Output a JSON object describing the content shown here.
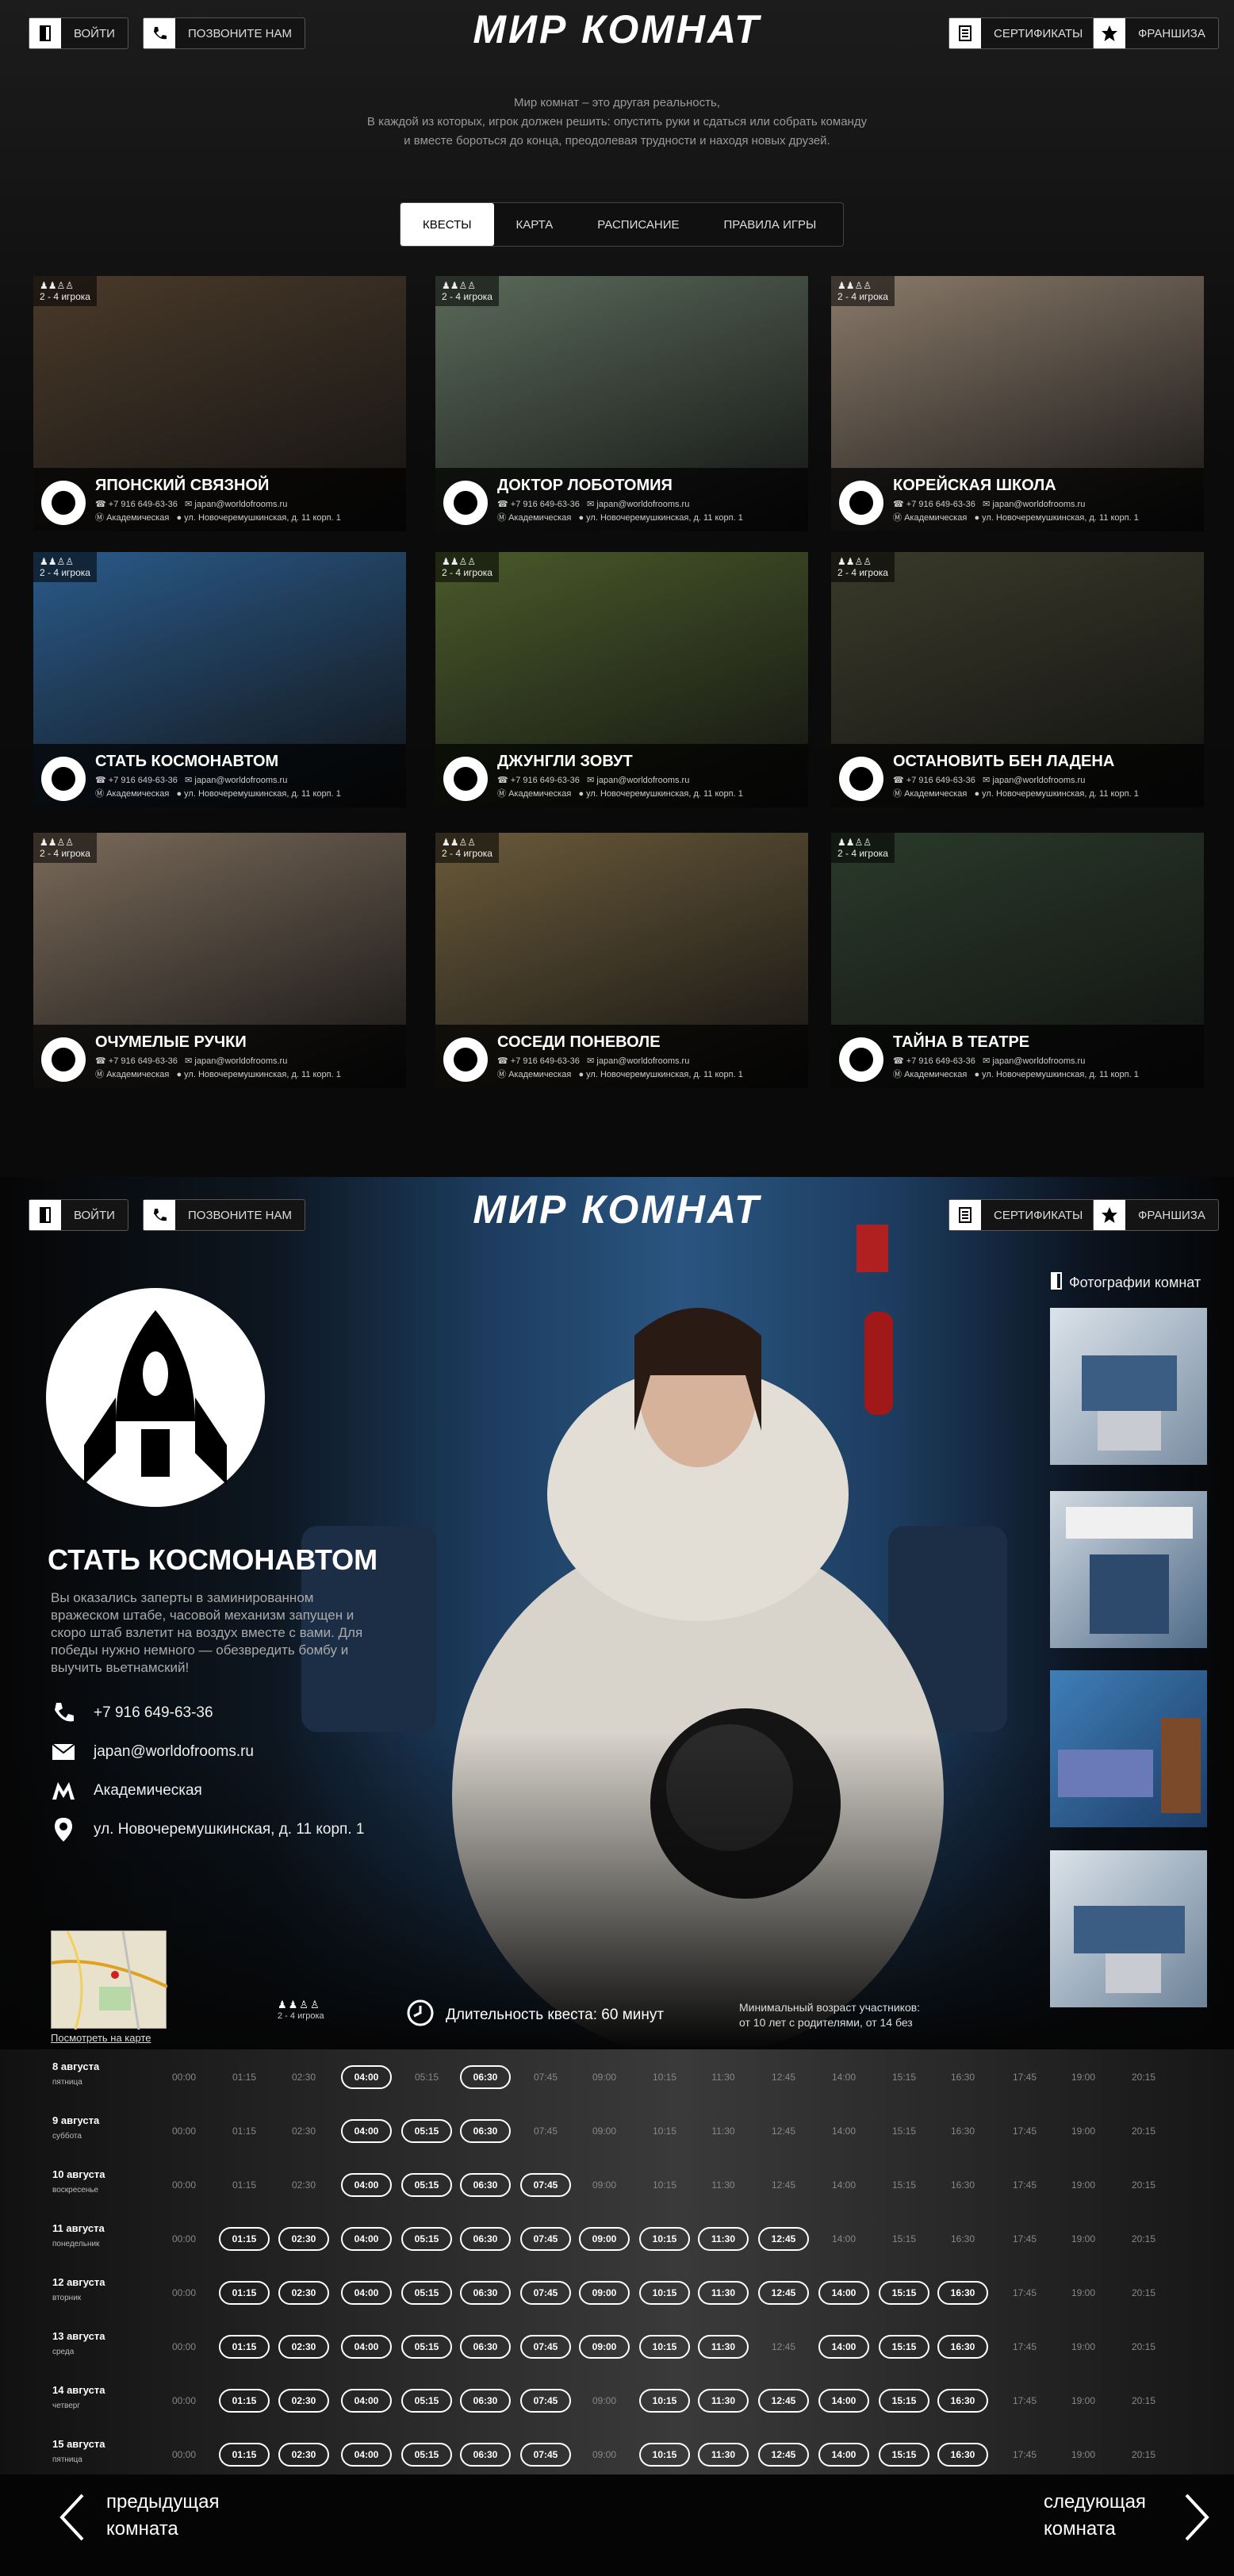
{
  "header": {
    "login": "ВОЙТИ",
    "call": "ПОЗВОНИТЕ НАМ",
    "logo": "МИР КОМНАТ",
    "certificates": "СЕРТИФИКАТЫ",
    "franchise": "ФРАНШИЗА"
  },
  "intro": {
    "line1": "Мир комнат – это другая реальность,",
    "line2": "В каждой из которых, игрок должен решить: опустить руки и сдаться или собрать команду",
    "line3": "и вместе бороться до конца, преодолевая трудности и находя новых друзей."
  },
  "tabs": [
    "КВЕСТЫ",
    "КАРТА",
    "РАСПИСАНИЕ",
    "ПРАВИЛА ИГРЫ"
  ],
  "quests": [
    {
      "title": "ЯПОНСКИЙ СВЯЗНОЙ",
      "players": "2 - 4 игрока",
      "phone": "+7 916 649-63-36",
      "email": "japan@worldofrooms.ru",
      "metro": "Академическая",
      "address": "ул. Новочеремушкинская, д. 11 корп. 1",
      "icon": "spiral-icon",
      "color": "#4a3a2a"
    },
    {
      "title": "ДОКТОР ЛОБОТОМИЯ",
      "players": "2 - 4 игрока",
      "phone": "+7 916 649-63-36",
      "email": "japan@worldofrooms.ru",
      "metro": "Академическая",
      "address": "ул. Новочеремушкинская, д. 11 корп. 1",
      "icon": "medical-icon",
      "color": "#5a6a5a"
    },
    {
      "title": "КОРЕЙСКАЯ ШКОЛА",
      "players": "2 - 4 игрока",
      "phone": "+7 916 649-63-36",
      "email": "japan@worldofrooms.ru",
      "metro": "Академическая",
      "address": "ул. Новочеремушкинская, д. 11 корп. 1",
      "icon": "school-icon",
      "color": "#8a7a6a"
    },
    {
      "title": "СТАТЬ КОСМОНАВТОМ",
      "players": "2 - 4 игрока",
      "phone": "+7 916 649-63-36",
      "email": "japan@worldofrooms.ru",
      "metro": "Академическая",
      "address": "ул. Новочеремушкинская, д. 11 корп. 1",
      "icon": "rocket-icon",
      "color": "#2a5a8a"
    },
    {
      "title": "ДЖУНГЛИ ЗОВУТ",
      "players": "2 - 4 игрока",
      "phone": "+7 916 649-63-36",
      "email": "japan@worldofrooms.ru",
      "metro": "Академическая",
      "address": "ул. Новочеремушкинская, д. 11 корп. 1",
      "icon": "tree-icon",
      "color": "#4a5a2a"
    },
    {
      "title": "ОСТАНОВИТЬ БЕН ЛАДЕНА",
      "players": "2 - 4 игрока",
      "phone": "+7 916 649-63-36",
      "email": "japan@worldofrooms.ru",
      "metro": "Академическая",
      "address": "ул. Новочеремушкинская, д. 11 корп. 1",
      "icon": "bomb-icon",
      "color": "#3a3a2a"
    },
    {
      "title": "ОЧУМЕЛЫЕ РУЧКИ",
      "players": "2 - 4 игрока",
      "phone": "+7 916 649-63-36",
      "email": "japan@worldofrooms.ru",
      "metro": "Академическая",
      "address": "ул. Новочеремушкинская, д. 11 корп. 1",
      "icon": "thumbs-up-icon",
      "color": "#7a6a5a"
    },
    {
      "title": "СОСЕДИ ПОНЕВОЛЕ",
      "players": "2 - 4 игрока",
      "phone": "+7 916 649-63-36",
      "email": "japan@worldofrooms.ru",
      "metro": "Академическая",
      "address": "ул. Новочеремушкинская, д. 11 корп. 1",
      "icon": "person-icon",
      "color": "#6a5a3a"
    },
    {
      "title": "ТАЙНА В ТЕАТРЕ",
      "players": "2 - 4 игрока",
      "phone": "+7 916 649-63-36",
      "email": "japan@worldofrooms.ru",
      "metro": "Академическая",
      "address": "ул. Новочеремушкинская, д. 11 корп. 1",
      "icon": "theater-masks-icon",
      "color": "#2a3a2a"
    }
  ],
  "detail": {
    "title": "СТАТЬ КОСМОНАВТОМ",
    "description": "Вы оказались заперты в заминированном вражеском штабе, часовой механизм запущен и скоро штаб взлетит на воздух вместе с вами. Для победы нужно немного — обезвредить бомбу и выучить вьетнамский!",
    "phone": "+7 916 649-63-36",
    "email": "japan@worldofrooms.ru",
    "metro": "Академическая",
    "address": "ул. Новочеремушкинская, д. 11 корп. 1",
    "map_link": "Посмотреть на карте",
    "players": "2 - 4 игрока",
    "duration": "Длительность квеста: 60 минут",
    "age_line1": "Минимальный возраст участников:",
    "age_line2": "от 10 лет с родителями, от 14 без",
    "photos_title": "Фотографии комнат"
  },
  "schedule": {
    "times": [
      "00:00",
      "01:15",
      "02:30",
      "04:00",
      "05:15",
      "06:30",
      "07:45",
      "09:00",
      "10:15",
      "11:30",
      "12:45",
      "14:00",
      "15:15",
      "16:30",
      "17:45",
      "19:00",
      "20:15"
    ],
    "days": [
      {
        "date": "8 августа",
        "weekday": "пятница",
        "booked": [
          3,
          5
        ]
      },
      {
        "date": "9 августа",
        "weekday": "суббота",
        "booked": [
          3,
          4,
          5
        ]
      },
      {
        "date": "10 августа",
        "weekday": "воскресенье",
        "booked": [
          3,
          4,
          5,
          6
        ]
      },
      {
        "date": "11 августа",
        "weekday": "понедельник",
        "booked": [
          1,
          2,
          3,
          4,
          5,
          6,
          7,
          8,
          9,
          10
        ]
      },
      {
        "date": "12 августа",
        "weekday": "вторник",
        "booked": [
          1,
          2,
          3,
          4,
          5,
          6,
          7,
          8,
          9,
          10,
          11,
          12,
          13
        ]
      },
      {
        "date": "13 августа",
        "weekday": "среда",
        "booked": [
          1,
          2,
          3,
          4,
          5,
          6,
          7,
          8,
          9,
          11,
          12,
          13
        ]
      },
      {
        "date": "14 августа",
        "weekday": "четверг",
        "booked": [
          1,
          2,
          3,
          4,
          5,
          6,
          8,
          9,
          10,
          11,
          12,
          13
        ]
      },
      {
        "date": "15 августа",
        "weekday": "пятница",
        "booked": [
          1,
          2,
          3,
          4,
          5,
          6,
          8,
          9,
          10,
          11,
          12,
          13
        ]
      }
    ]
  },
  "nav": {
    "prev_line1": "предыдущая",
    "prev_line2": "комната",
    "next_line1": "следующая",
    "next_line2": "комната"
  }
}
